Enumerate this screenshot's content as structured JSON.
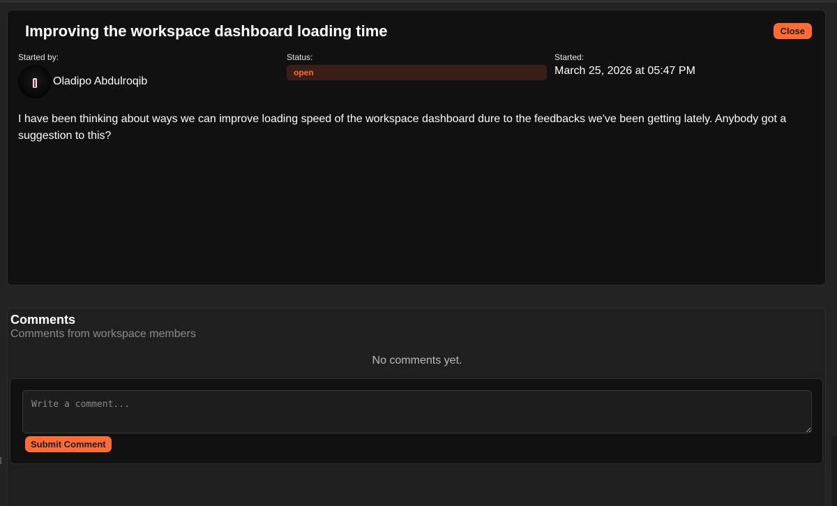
{
  "discussion": {
    "title": "Improving the workspace dashboard loading time",
    "close_label": "Close",
    "started_by_label": "Started by:",
    "author_name": "Oladipo Abdulroqib",
    "status_label": "Status:",
    "status_value": "open",
    "started_label": "Started:",
    "started_value": "March 25, 2026 at 05:47 PM",
    "body": "I have been thinking about ways we can improve loading speed of the workspace dashboard dure to the feedbacks we've been getting lately. Anybody got a suggestion to this?"
  },
  "comments": {
    "title": "Comments",
    "subtitle": "Comments from workspace members",
    "empty_text": "No comments yet.",
    "input_placeholder": "Write a comment...",
    "input_value": "",
    "submit_label": "Submit Comment"
  },
  "colors": {
    "accent": "#ff6b35",
    "status_bg": "#3a1e16",
    "card_bg": "#111111",
    "page_bg": "#232323"
  },
  "icons": {
    "avatar": "user-avatar"
  }
}
